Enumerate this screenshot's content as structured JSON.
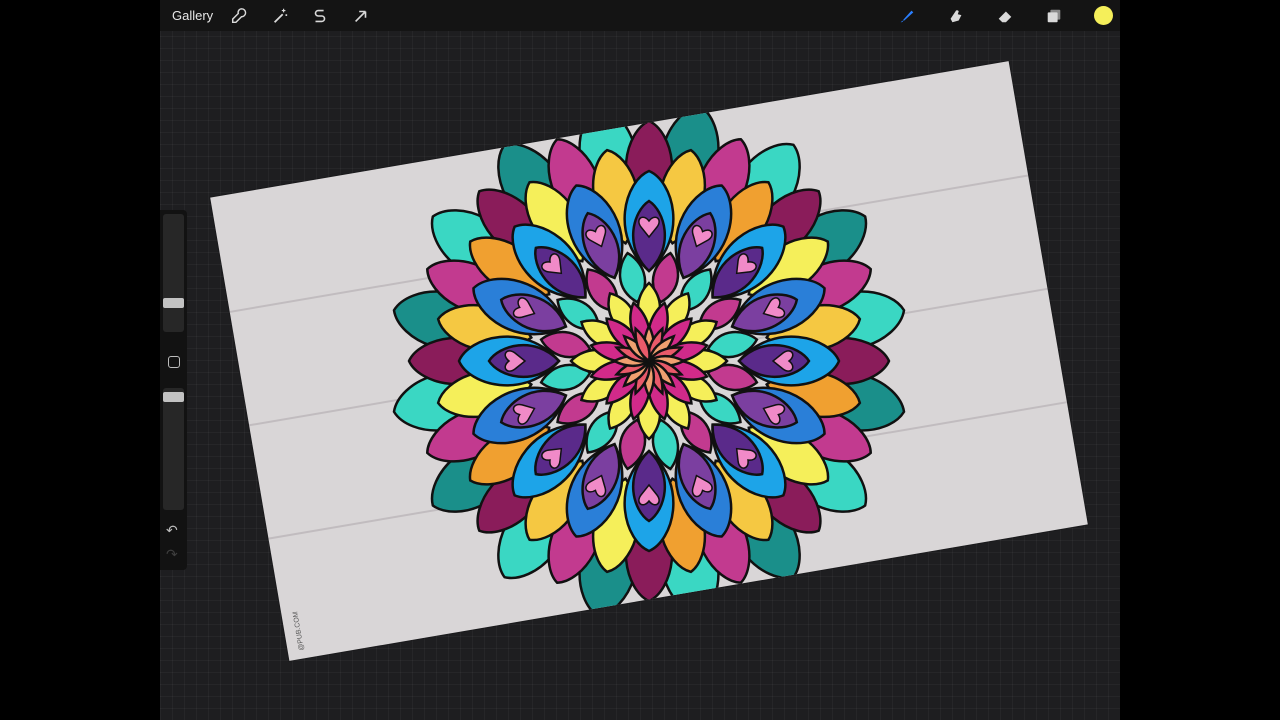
{
  "topbar": {
    "gallery_label": "Gallery",
    "left_tools": [
      {
        "name": "actions",
        "icon": "wrench-icon"
      },
      {
        "name": "adjustments",
        "icon": "magic-wand-icon"
      },
      {
        "name": "selection",
        "icon": "selection-s-icon"
      },
      {
        "name": "transform",
        "icon": "arrow-cursor-icon"
      }
    ],
    "right_tools": [
      {
        "name": "brush",
        "icon": "brush-icon",
        "active": true
      },
      {
        "name": "smudge",
        "icon": "smudge-finger-icon"
      },
      {
        "name": "eraser",
        "icon": "eraser-icon"
      },
      {
        "name": "layers",
        "icon": "layers-icon"
      }
    ],
    "current_color": "#f5ef5a",
    "active_tool_color": "#2a7fff"
  },
  "sidebar": {
    "brush_size_icon": "slider-handle",
    "opacity_icon": "slider-handle",
    "modify_button_icon": "square-icon",
    "undo_icon": "undo-icon",
    "redo_icon": "redo-icon"
  },
  "canvas": {
    "credit_text": "@PUB.COM"
  }
}
